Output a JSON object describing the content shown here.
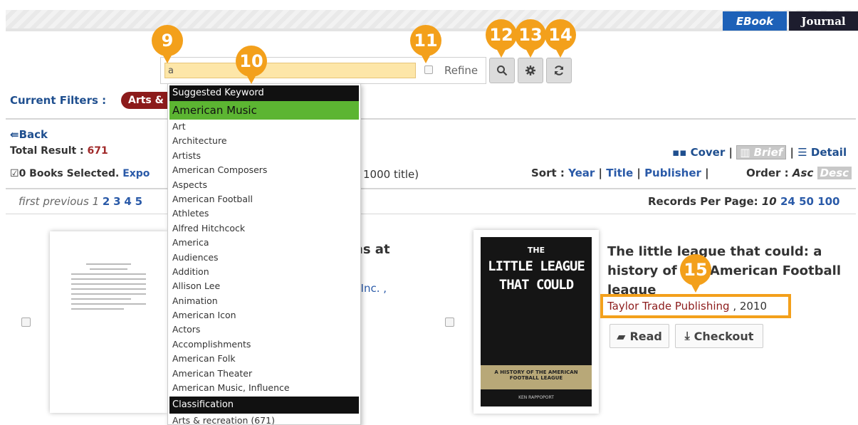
{
  "tabs": [
    "EBook",
    "Journal"
  ],
  "search": {
    "value": "a",
    "refine_label": "Refine"
  },
  "tools": {
    "search_icon": "search-icon",
    "settings_icon": "gear-icon",
    "refresh_icon": "refresh-icon"
  },
  "badges": [
    "9",
    "10",
    "11",
    "12",
    "13",
    "14",
    "15"
  ],
  "filters": {
    "label": "Current Filters :",
    "pill": "Arts & recreation"
  },
  "back": "Back",
  "total": {
    "label": "Total Result :",
    "value": "671"
  },
  "selected": {
    "text": "0 Books Selected.",
    "export": "Expo",
    "limit": "1000 title)"
  },
  "views": {
    "cover": "Cover",
    "brief": "Brief",
    "detail": "Detail"
  },
  "sort": {
    "label": "Sort :",
    "year": "Year",
    "title": "Title",
    "publisher": "Publisher"
  },
  "order": {
    "label": "Order :",
    "asc": "Asc",
    "desc": "Desc"
  },
  "pager": {
    "first": "first",
    "previous": "previous",
    "current": "1",
    "pages": [
      "2",
      "3",
      "4",
      "5"
    ]
  },
  "rpp": {
    "label": "Records Per Page:",
    "current": "10",
    "options": [
      "24",
      "50",
      "100"
    ]
  },
  "dropdown": {
    "header": "Suggested Keyword",
    "highlighted": "American Music",
    "items": [
      "Art",
      "Architecture",
      "Artists",
      "American Composers",
      "Aspects",
      "American Football",
      "Athletes",
      "Alfred Hitchcock",
      "America",
      "Audiences",
      "Addition",
      "Allison Lee",
      "Animation",
      "American Icon",
      "Actors",
      "Accomplishments",
      "American Folk",
      "American Theater",
      "American Music, Influence"
    ],
    "header2": "Classification",
    "classification_items": [
      "Arts & recreation (671)"
    ]
  },
  "records": [
    {
      "title_partial": "ns at",
      "publisher_partial": ", Inc. ,"
    },
    {
      "title": "The little league that could: a history of the American Football league",
      "publisher": "Taylor Trade Publishing",
      "year": ", 2010",
      "cover": {
        "top": "THE",
        "title": "LITTLE LEAGUE THAT COULD",
        "strip": "A HISTORY OF THE AMERICAN FOOTBALL LEAGUE",
        "author": "KEN RAPPOPORT"
      },
      "read_label": "Read",
      "checkout_label": "Checkout"
    }
  ]
}
